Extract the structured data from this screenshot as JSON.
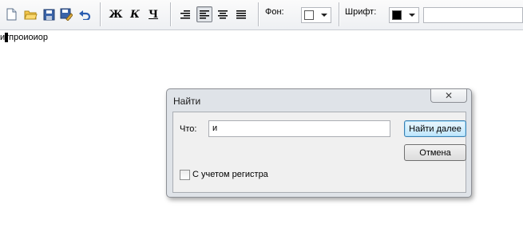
{
  "toolbar": {
    "file_buttons": [
      {
        "name": "new-document-icon"
      },
      {
        "name": "open-folder-icon"
      },
      {
        "name": "save-icon"
      },
      {
        "name": "save-as-icon"
      },
      {
        "name": "undo-icon"
      }
    ],
    "format": {
      "bold": "Ж",
      "italic": "К",
      "underline": "Ч"
    },
    "align_buttons": [
      {
        "name": "align-right-icon",
        "selected": false
      },
      {
        "name": "align-left-icon",
        "selected": true
      },
      {
        "name": "align-center-icon",
        "selected": false
      },
      {
        "name": "align-justify-icon",
        "selected": false
      }
    ],
    "background_label": "Фон:",
    "background_color": "#ffffff",
    "font_label": "Шрифт:",
    "font_color": "#000000"
  },
  "editor": {
    "text": "итпроиоиор"
  },
  "dialog": {
    "title": "Найти",
    "close_icon": "close-icon",
    "what_label": "Что:",
    "search_value": "и",
    "find_next_label": "Найти далее",
    "cancel_label": "Отмена",
    "match_case_label": "С учетом регистра",
    "match_case_checked": false
  },
  "colors": {
    "accent": "#3c7fb1",
    "default_button": "#bee6fd"
  }
}
